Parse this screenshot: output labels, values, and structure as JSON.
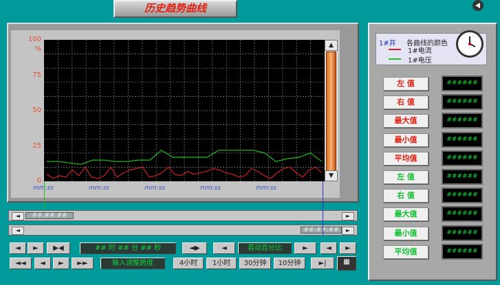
{
  "title": "历史趋势曲线",
  "chart_data": {
    "type": "line",
    "y_ticks": [
      "100",
      "75",
      "50",
      "25",
      "0"
    ],
    "y_unit": "%",
    "ylim": [
      0,
      100
    ],
    "x_labels": [
      "mm:ss",
      "mm:ss",
      "mm:ss",
      "mm:ss",
      "mm:ss"
    ],
    "series": [
      {
        "name": "1#电流",
        "color": "#d02020",
        "values": [
          5,
          2,
          4,
          3,
          8,
          4,
          10,
          3,
          2,
          4,
          10,
          3,
          6,
          8,
          9,
          10,
          3,
          4,
          6,
          10,
          5,
          4,
          7,
          5,
          6,
          7,
          9,
          8,
          6,
          5,
          3,
          4,
          9,
          7,
          4,
          2,
          6,
          9,
          10,
          6,
          3,
          8,
          10,
          6
        ]
      },
      {
        "name": "1#电压",
        "color": "#20c020",
        "values": [
          14,
          14,
          13,
          12,
          15,
          15,
          14,
          14,
          15,
          15,
          22,
          17,
          17,
          17,
          17,
          22,
          22,
          22,
          22,
          20,
          14,
          16,
          17,
          20,
          14
        ]
      }
    ]
  },
  "legend": {
    "well": "1#井",
    "heading": "各曲线的颜色"
  },
  "scroll1_time": "##:##:##",
  "scroll2_time": "##:##:##",
  "controls": {
    "time_display": "## 时 ## 分 ## 秒",
    "auto_percent": "若动百分比",
    "input_step": "输入调整跨度",
    "spans": [
      "4小时",
      "1小时",
      "30分钟",
      "10分钟"
    ]
  },
  "stats": {
    "red_labels": [
      "左 值",
      "右 值",
      "最大值",
      "最小值",
      "平均值"
    ],
    "green_labels": [
      "左 值",
      "右 值",
      "最大值",
      "最小值",
      "平均值"
    ],
    "value_text": "######",
    "red_color": "#e02010",
    "green_color": "#10c030"
  }
}
